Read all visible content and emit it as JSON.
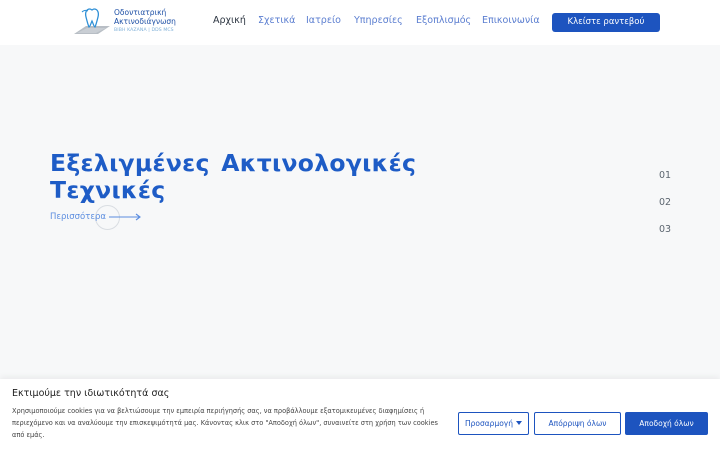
{
  "header": {
    "logo": {
      "title_line1": "Οδοντιατρική",
      "title_line2": "Ακτινοδιάγνωση",
      "subtitle": "ΒΙΒΗ ΚΑΖΑΝΑ | DDS MCS"
    },
    "nav": [
      {
        "label": "Αρχική",
        "active": true
      },
      {
        "label": "Σχετικά",
        "active": false
      },
      {
        "label": "Ιατρείο",
        "active": false
      },
      {
        "label": "Υπηρεσίες",
        "active": false
      },
      {
        "label": "Εξοπλισμός",
        "active": false
      },
      {
        "label": "Επικοινωνία",
        "active": false
      }
    ],
    "cta_label": "Κλείστε ραντεβού"
  },
  "hero": {
    "title_line1": "Εξελιγμένες Ακτινολογικές",
    "title_line2": "Τεχνικές",
    "more_label": "Περισσότερα"
  },
  "slider": {
    "numbers": [
      "01",
      "02",
      "03"
    ]
  },
  "cookie": {
    "title": "Εκτιμούμε την ιδιωτικότητά σας",
    "text": "Χρησιμοποιούμε cookies για να βελτιώσουμε την εμπειρία περιήγησής σας, να προβάλλουμε εξατομικευμένες διαφημίσεις ή περιεχόμενο και να αναλύουμε την επισκεψιμότητά μας. Κάνοντας κλικ στο \"Αποδοχή όλων\", συναινείτε στη χρήση των cookies από εμάς.",
    "customize_label": "Προσαρμογή",
    "reject_label": "Απόρριψη όλων",
    "accept_label": "Αποδοχή όλων"
  },
  "colors": {
    "brand_blue": "#1d54bf",
    "nav_link": "#5b7ed0",
    "background": "#f7f8f9"
  },
  "icons": [
    "logo-tooth-icon",
    "arrow-right-icon",
    "chevron-down-icon"
  ]
}
